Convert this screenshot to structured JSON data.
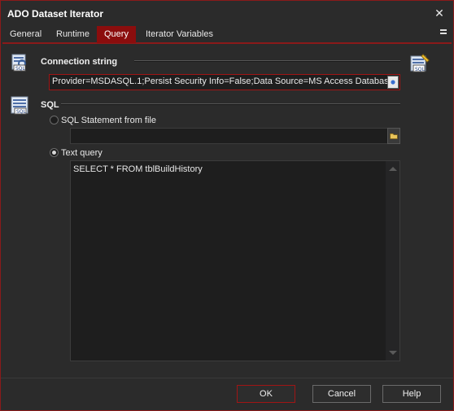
{
  "window": {
    "title": "ADO Dataset Iterator",
    "close_glyph": "✕"
  },
  "tabs": [
    {
      "label": "General"
    },
    {
      "label": "Runtime"
    },
    {
      "label": "Query",
      "active": true
    },
    {
      "label": "Iterator Variables"
    }
  ],
  "connection": {
    "label": "Connection string",
    "value": "Provider=MSDASQL.1;Persist Security Info=False;Data Source=MS Access Database"
  },
  "sql": {
    "label": "SQL",
    "option_file_label": "SQL Statement from file",
    "option_text_label": "Text query",
    "selected": "text",
    "query_text": "SELECT * FROM tblBuildHistory",
    "file_path": ""
  },
  "buttons": {
    "ok": "OK",
    "cancel": "Cancel",
    "help": "Help"
  },
  "colors": {
    "accent": "#8b0d0d",
    "background": "#2b2b2b",
    "field": "#1e1e1e"
  },
  "icons": [
    "sql-connection-icon",
    "sql-edit-icon",
    "sql-table-icon",
    "browse-icon",
    "folder-icon",
    "close-icon",
    "tab-menu-icon"
  ]
}
